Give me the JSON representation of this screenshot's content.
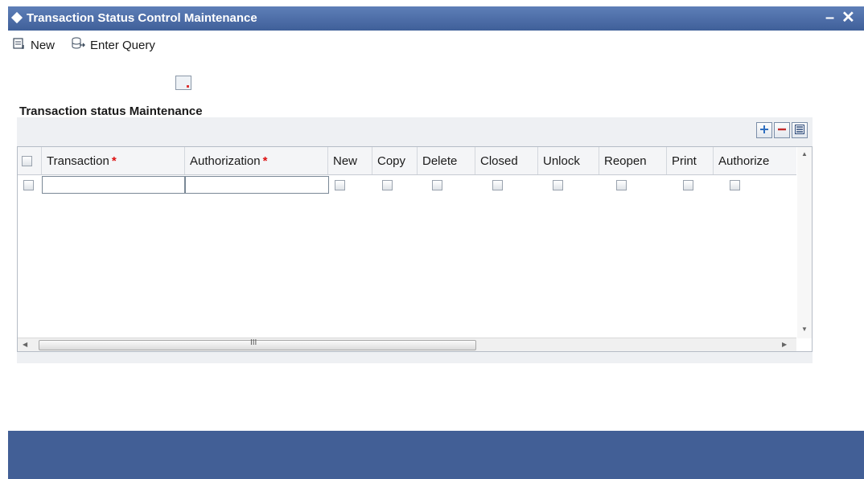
{
  "window": {
    "title": "Transaction Status Control Maintenance",
    "minimize": "–",
    "close": "✕"
  },
  "toolbar": {
    "new_label": "New",
    "enter_query_label": "Enter Query"
  },
  "section": {
    "title": "Transaction status Maintenance"
  },
  "grid": {
    "columns": {
      "transaction": "Transaction",
      "authorization": "Authorization",
      "new": "New",
      "copy": "Copy",
      "delete": "Delete",
      "closed": "Closed",
      "unlock": "Unlock",
      "reopen": "Reopen",
      "print": "Print",
      "authorize": "Authorize"
    },
    "required_marker": "*",
    "rows": [
      {
        "transaction": "",
        "authorization": ""
      }
    ],
    "scroll_grip": "III"
  },
  "colors": {
    "title_bar": "#4a6aa6",
    "footer_bar": "#425f96",
    "required": "#dd1111"
  }
}
